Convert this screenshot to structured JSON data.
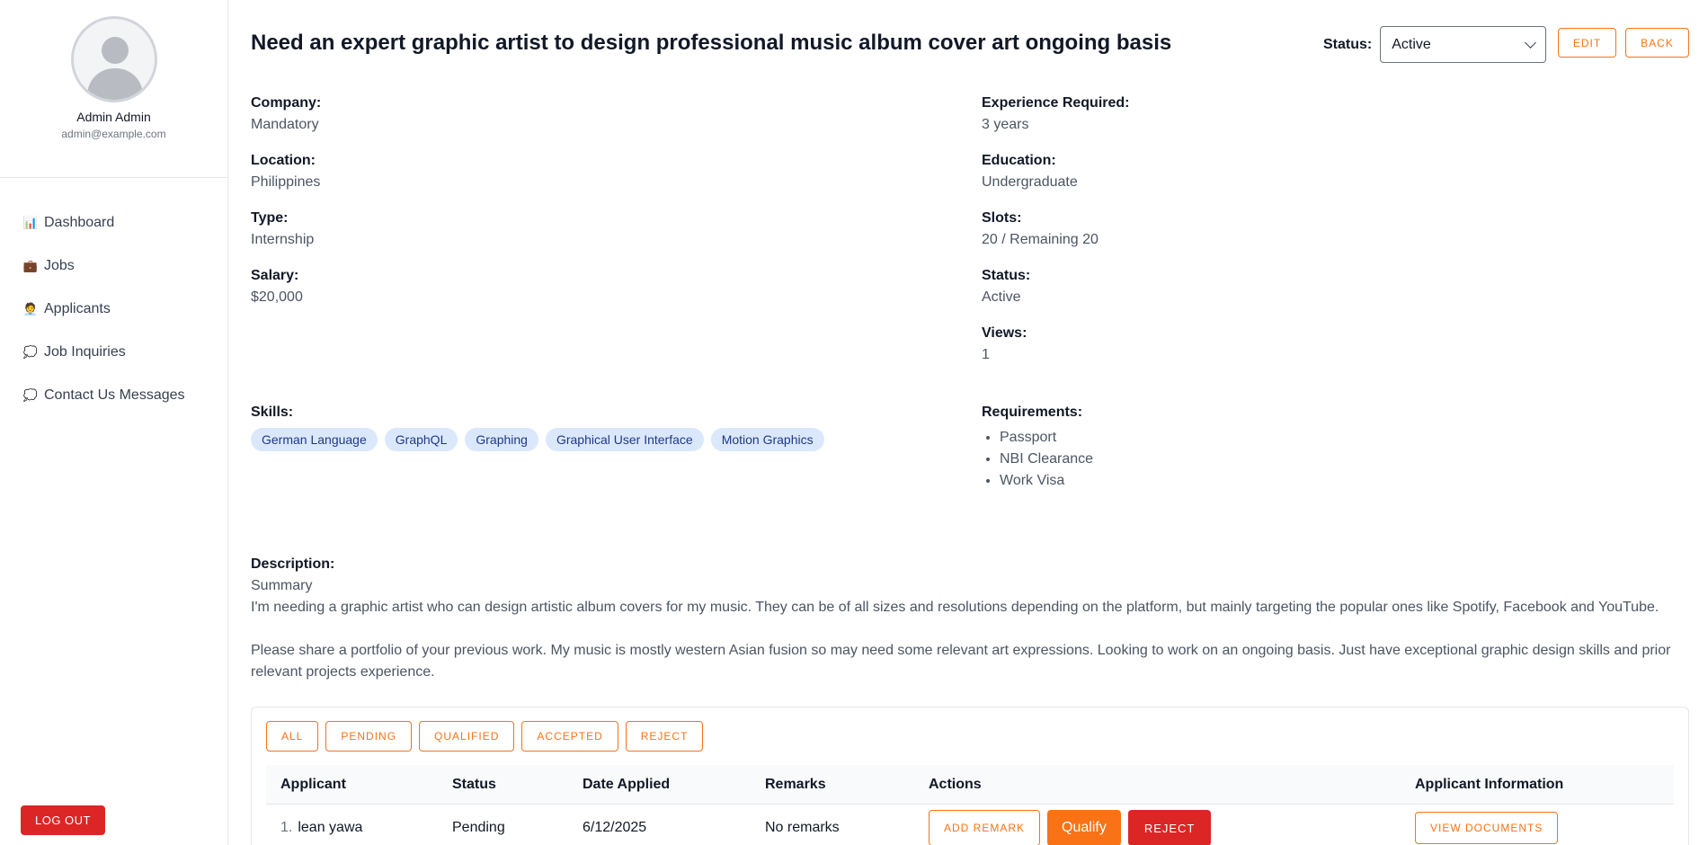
{
  "user": {
    "name": "Admin Admin",
    "email": "admin@example.com"
  },
  "nav": [
    {
      "label": "Dashboard",
      "icon": "📊",
      "icon_name": "dashboard-icon"
    },
    {
      "label": "Jobs",
      "icon": "💼",
      "icon_name": "briefcase-icon"
    },
    {
      "label": "Applicants",
      "icon": "🧑‍💼",
      "icon_name": "person-icon"
    },
    {
      "label": "Job Inquiries",
      "icon": "💭",
      "icon_name": "speech-bubble-icon"
    },
    {
      "label": "Contact Us Messages",
      "icon": "💭",
      "icon_name": "speech-bubble-icon"
    }
  ],
  "logout_label": "LOG OUT",
  "job": {
    "title": "Need an expert graphic artist to design professional music album cover art ongoing basis",
    "status_label": "Status:",
    "status_value": "Active",
    "edit_label": "EDIT",
    "back_label": "BACK",
    "left_fields": [
      {
        "label": "Company:",
        "value": "Mandatory"
      },
      {
        "label": "Location:",
        "value": "Philippines"
      },
      {
        "label": "Type:",
        "value": "Internship"
      },
      {
        "label": "Salary:",
        "value": "$20,000"
      }
    ],
    "right_fields": [
      {
        "label": "Experience Required:",
        "value": "3 years"
      },
      {
        "label": "Education:",
        "value": "Undergraduate"
      },
      {
        "label": "Slots:",
        "value": "20 / Remaining 20"
      },
      {
        "label": "Status:",
        "value": "Active"
      },
      {
        "label": "Views:",
        "value": "1"
      }
    ],
    "skills_label": "Skills:",
    "skills": [
      "German Language",
      "GraphQL",
      "Graphing",
      "Graphical User Interface",
      "Motion Graphics"
    ],
    "requirements_label": "Requirements:",
    "requirements": [
      "Passport",
      "NBI Clearance",
      "Work Visa"
    ],
    "description_label": "Description:",
    "description": [
      "Summary",
      "I'm needing a graphic artist who can design artistic album covers for my music. They can be of all sizes and resolutions depending on the platform, but mainly targeting the popular ones like Spotify, Facebook and YouTube.",
      "",
      "Please share a portfolio of your previous work. My music is mostly western Asian fusion so may need some relevant art expressions. Looking to work on an ongoing basis. Just have exceptional graphic design skills and prior relevant projects experience."
    ]
  },
  "filters": [
    "ALL",
    "PENDING",
    "QUALIFIED",
    "ACCEPTED",
    "REJECT"
  ],
  "table": {
    "headers": [
      "Applicant",
      "Status",
      "Date Applied",
      "Remarks",
      "Actions",
      "Applicant Information"
    ],
    "rows": [
      {
        "num": "1.",
        "name": "lean yawa",
        "status": "Pending",
        "date": "6/12/2025",
        "remarks": "No remarks",
        "add_remark": "ADD REMARK",
        "qualify": "Qualify",
        "reject": "REJECT",
        "view_documents": "VIEW DOCUMENTS"
      }
    ]
  },
  "colors": {
    "accent": "#f97316",
    "danger": "#dc2626",
    "chip_bg": "#dbe8fb"
  }
}
